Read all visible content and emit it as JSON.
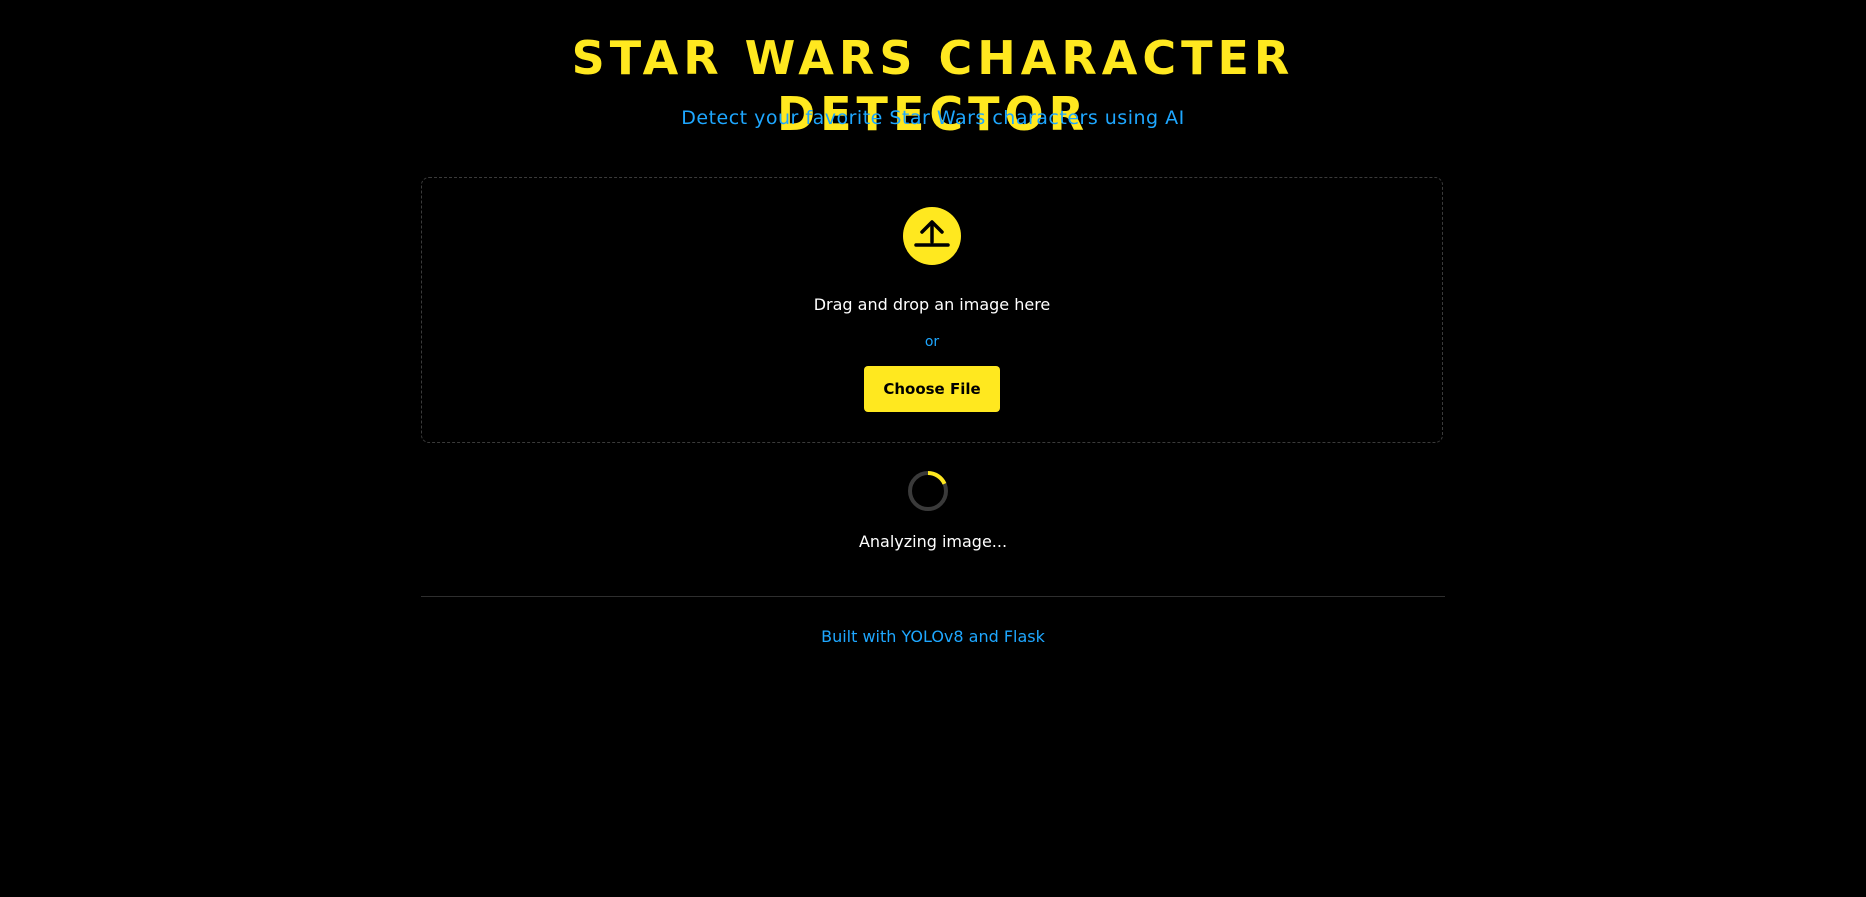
{
  "header": {
    "title": "STAR WARS CHARACTER DETECTOR",
    "subtitle": "Detect your favorite Star Wars characters using AI"
  },
  "upload": {
    "icon": "upload-icon",
    "drop_text": "Drag and drop an image here",
    "or_text": "or",
    "button_label": "Choose File"
  },
  "status": {
    "spinner_icon": "loading-spinner-icon",
    "analyzing_text": "Analyzing image..."
  },
  "footer": {
    "text": "Built with YOLOv8 and Flask"
  },
  "colors": {
    "background": "#000000",
    "accent_yellow": "#FFE81F",
    "accent_blue": "#1EA7FF",
    "text": "#FFFFFF"
  }
}
